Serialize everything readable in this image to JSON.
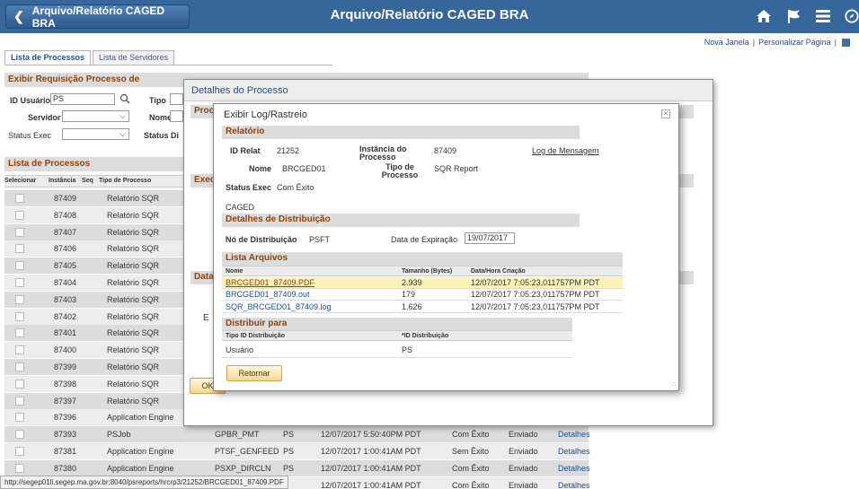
{
  "header": {
    "back_label": "Arquivo/Relatório CAGED BRA",
    "title": "Arquivo/Relatório CAGED BRA",
    "icons": [
      "home-icon",
      "flag-icon",
      "menu-icon",
      "compass-icon"
    ]
  },
  "toplinks": {
    "new_window": "Nova Janela",
    "personalize": "Personalizar Página"
  },
  "tabs": [
    {
      "label": "Lista de Processos"
    },
    {
      "label": "Lista de Servidores"
    }
  ],
  "filters": {
    "section_title": "Exibir Requisição Processo de",
    "user_id_label": "ID Usuário",
    "user_id_value": "PS",
    "type_label": "Tipo",
    "server_label": "Servidor",
    "name_label": "Nome",
    "status_exec_label": "Status Exec",
    "status_di_label": "Status Di"
  },
  "process_list": {
    "title": "Lista de Processos",
    "columns": [
      "Selecionar",
      "Instância",
      "Seq",
      "Tipo de Processo"
    ],
    "rows": [
      {
        "instance": "87409",
        "type": "Relatório SQR"
      },
      {
        "instance": "87408",
        "type": "Relatório SQR"
      },
      {
        "instance": "87407",
        "type": "Relatório SQR"
      },
      {
        "instance": "87406",
        "type": "Relatório SQR"
      },
      {
        "instance": "87405",
        "type": "Relatório SQR"
      },
      {
        "instance": "87404",
        "type": "Relatório SQR"
      },
      {
        "instance": "87403",
        "type": "Relatório SQR"
      },
      {
        "instance": "87402",
        "type": "Relatório SQR"
      },
      {
        "instance": "87401",
        "type": "Relatório SQR"
      },
      {
        "instance": "87400",
        "type": "Relatório SQR"
      },
      {
        "instance": "87399",
        "type": "Relatório SQR"
      },
      {
        "instance": "87398",
        "type": "Relatório SQR"
      },
      {
        "instance": "87397",
        "type": "Relatório SQR"
      },
      {
        "instance": "87396",
        "type": "Application Engine"
      },
      {
        "instance": "87393",
        "type": "PSJob",
        "name": "GPBR_PMT",
        "user": "PS",
        "datetime": "12/07/2017 5:50:40PM PDT",
        "run_status": "Com Êxito",
        "dist_status": "Enviado",
        "details": "Detalhes"
      },
      {
        "instance": "87381",
        "type": "Application Engine",
        "name": "PTSF_GENFEED",
        "user": "PS",
        "datetime": "12/07/2017 1:00:41AM PDT",
        "run_status": "Sem Êxito",
        "dist_status": "Enviado",
        "details": "Detalhes"
      },
      {
        "instance": "87380",
        "type": "Application Engine",
        "name": "PSXP_DIRCLN",
        "user": "PS",
        "datetime": "12/07/2017 1:00:41AM PDT",
        "run_status": "Com Êxito",
        "dist_status": "Enviado",
        "details": "Detalhes"
      },
      {
        "instance": "",
        "type": "",
        "name": "",
        "user": "",
        "datetime": "12/07/2017 1:00:41AM PDT",
        "run_status": "Com Êxito",
        "dist_status": "Enviado",
        "details": "Detalhes"
      }
    ]
  },
  "modal_process": {
    "title": "Detalhes do Processo",
    "proc_label": "Proce",
    "exec_label": "Exec",
    "data_label": "Data/H",
    "e_label": "E",
    "ok_label": "OK"
  },
  "modal_log": {
    "title": "Exibir Log/Rastreio",
    "report_section": "Relatório",
    "report_id_label": "ID Relat",
    "report_id": "21252",
    "instance_label": "Instância do Processo",
    "instance_value": "87409",
    "message_log_link": "Log de Mensagem",
    "name_label": "Nome",
    "name_value": "BRCGED01",
    "ptype_label": "Tipo de Processo",
    "ptype_value": "SQR Report",
    "status_label": "Status Exec",
    "status_value": "Com Êxito",
    "description": "CAGED",
    "dist_section": "Detalhes de Distribuição",
    "dist_node_label": "Nó de Distribuição",
    "dist_node_value": "PSFT",
    "expiry_label": "Data de Expiração",
    "expiry_value": "19/07/2017",
    "files_section": "Lista Arquivos",
    "files_columns": [
      "Nome",
      "Tamanho (Bytes)",
      "Data/Hora Criação"
    ],
    "files": [
      {
        "name": "BRCGED01_87409.PDF",
        "size": "2.939",
        "created": "12/07/2017  7:05:23,011757PM PDT"
      },
      {
        "name": "BRCGED01_87409.out",
        "size": "179",
        "created": "12/07/2017  7:05:23,011757PM PDT"
      },
      {
        "name": "SQR_BRCGED01_87409.log",
        "size": "1.626",
        "created": "12/07/2017  7:05:23,011757PM PDT"
      }
    ],
    "distribute_section": "Distribuir para",
    "distribute_columns": [
      "Tipo ID Distribuição",
      "*ID Distribuição"
    ],
    "distribute_type": "Usuário",
    "distribute_id": "PS",
    "return_button": "Retornar",
    "close_glyph": "×"
  },
  "status_url": "http://segep01li.segep.ma.gov.br:8040/psreports/hrcrp3/21252/BRCGED01_87409.PDF"
}
